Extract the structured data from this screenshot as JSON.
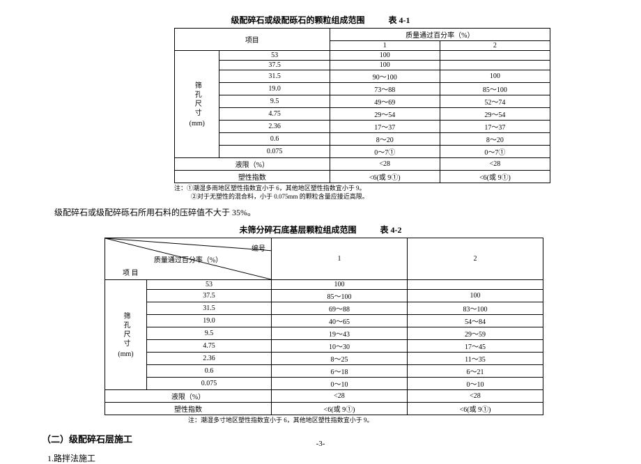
{
  "table1": {
    "title_main": "级配碎石或级配砾石的颗粒组成范围",
    "title_ref": "表 4-1",
    "header_item": "项目",
    "header_pass": "质量通过百分率（%）",
    "cols": [
      "1",
      "2"
    ],
    "row_label_sieve": "筛孔尺寸",
    "row_label_unit": "(mm)",
    "data": [
      {
        "s": "53",
        "v1": "100",
        "v2": ""
      },
      {
        "s": "37.5",
        "v1": "100",
        "v2": ""
      },
      {
        "s": "31.5",
        "v1": "90～100",
        "v2": "100"
      },
      {
        "s": "19.0",
        "v1": "73～88",
        "v2": "85～100"
      },
      {
        "s": "9.5",
        "v1": "49～69",
        "v2": "52～74"
      },
      {
        "s": "4.75",
        "v1": "29～54",
        "v2": "29～54"
      },
      {
        "s": "2.36",
        "v1": "17～37",
        "v2": "17～37"
      },
      {
        "s": "0.6",
        "v1": "8～20",
        "v2": "8～20"
      },
      {
        "s": "0.075",
        "v1": "0～7①",
        "v2": "0～7①"
      }
    ],
    "extra_rows": [
      {
        "label": "液限（%）",
        "v1": "<28",
        "v2": "<28"
      },
      {
        "label": "塑性指数",
        "v1": "<6(或 9①)",
        "v2": "<6(或 9①)"
      }
    ],
    "note_l1": "注：①潮湿多雨地区塑性指数宜小于 6，其他地区塑性指数宜小于 9。",
    "note_l2": "②对于无塑性的混合料，小于 0.075mm 的颗粒含量应接近高限。"
  },
  "body_text": "级配碎石或级配碎砾石所用石料的压碎值不大于 35%。",
  "table2": {
    "title_main": "未筛分碎石底基层颗粒组成范围",
    "title_ref": "表 4-2",
    "hdr_pass": "质量通过百分率（%）",
    "hdr_no": "编号",
    "hdr_item": "项 目",
    "cols": [
      "1",
      "2"
    ],
    "row_label_sieve": "筛孔尺寸",
    "row_label_unit": "(mm)",
    "data": [
      {
        "s": "53",
        "v1": "100",
        "v2": ""
      },
      {
        "s": "37.5",
        "v1": "85～100",
        "v2": "100"
      },
      {
        "s": "31.5",
        "v1": "69～88",
        "v2": "83～100"
      },
      {
        "s": "19.0",
        "v1": "40～65",
        "v2": "54～84"
      },
      {
        "s": "9.5",
        "v1": "19～43",
        "v2": "29～59"
      },
      {
        "s": "4.75",
        "v1": "10～30",
        "v2": "17～45"
      },
      {
        "s": "2.36",
        "v1": "8～25",
        "v2": "11～35"
      },
      {
        "s": "0.6",
        "v1": "6～18",
        "v2": "6～21"
      },
      {
        "s": "0.075",
        "v1": "0～10",
        "v2": "0～10"
      }
    ],
    "extra_rows": [
      {
        "label": "液限（%）",
        "v1": "<28",
        "v2": "<28"
      },
      {
        "label": "塑性指数",
        "v1": "<6(或 9①)",
        "v2": "<6(或 9①)"
      }
    ],
    "note": "注：潮湿多寸地区塑性指数宜小于 6，其他地区塑性指数宜小于 9。"
  },
  "section_heading": "（二）级配碎石层施工",
  "sub_heading": "1.路拌法施工",
  "page_num": "-3-",
  "chart_data": [
    {
      "type": "table",
      "title": "级配碎石或级配砾石的颗粒组成范围 表 4-1",
      "columns": [
        "筛孔尺寸(mm)",
        "质量通过百分率(%) 1",
        "质量通过百分率(%) 2"
      ],
      "rows": [
        [
          "53",
          "100",
          ""
        ],
        [
          "37.5",
          "100",
          ""
        ],
        [
          "31.5",
          "90～100",
          "100"
        ],
        [
          "19.0",
          "73～88",
          "85～100"
        ],
        [
          "9.5",
          "49～69",
          "52～74"
        ],
        [
          "4.75",
          "29～54",
          "29～54"
        ],
        [
          "2.36",
          "17～37",
          "17～37"
        ],
        [
          "0.6",
          "8～20",
          "8～20"
        ],
        [
          "0.075",
          "0～7",
          "0～7"
        ],
        [
          "液限（%）",
          "<28",
          "<28"
        ],
        [
          "塑性指数",
          "<6(或9)",
          "<6(或9)"
        ]
      ]
    },
    {
      "type": "table",
      "title": "未筛分碎石底基层颗粒组成范围 表 4-2",
      "columns": [
        "筛孔尺寸(mm)",
        "质量通过百分率(%) 1",
        "质量通过百分率(%) 2"
      ],
      "rows": [
        [
          "53",
          "100",
          ""
        ],
        [
          "37.5",
          "85～100",
          "100"
        ],
        [
          "31.5",
          "69～88",
          "83～100"
        ],
        [
          "19.0",
          "40～65",
          "54～84"
        ],
        [
          "9.5",
          "19～43",
          "29～59"
        ],
        [
          "4.75",
          "10～30",
          "17～45"
        ],
        [
          "2.36",
          "8～25",
          "11～35"
        ],
        [
          "0.6",
          "6～18",
          "6～21"
        ],
        [
          "0.075",
          "0～10",
          "0～10"
        ],
        [
          "液限（%）",
          "<28",
          "<28"
        ],
        [
          "塑性指数",
          "<6(或9)",
          "<6(或9)"
        ]
      ]
    }
  ]
}
